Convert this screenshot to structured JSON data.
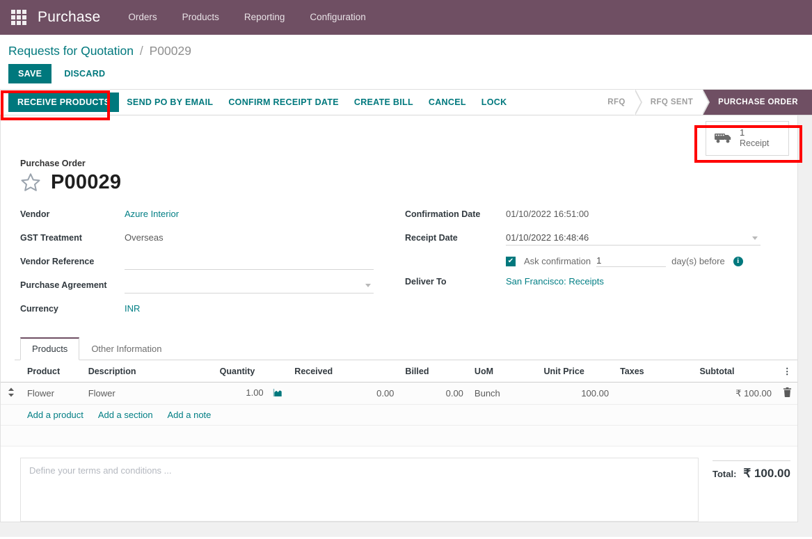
{
  "navbar": {
    "apps_icon": "apps-grid-icon",
    "brand": "Purchase",
    "menu": [
      "Orders",
      "Products",
      "Reporting",
      "Configuration"
    ]
  },
  "breadcrumb": {
    "parent": "Requests for Quotation",
    "separator": "/",
    "current": "P00029"
  },
  "edit_controls": {
    "save_label": "SAVE",
    "discard_label": "DISCARD"
  },
  "statusbar": {
    "buttons": [
      {
        "label": "RECEIVE PRODUCTS",
        "primary": true
      },
      {
        "label": "SEND PO BY EMAIL",
        "primary": false
      },
      {
        "label": "CONFIRM RECEIPT DATE",
        "primary": false
      },
      {
        "label": "CREATE BILL",
        "primary": false
      },
      {
        "label": "CANCEL",
        "primary": false
      },
      {
        "label": "LOCK",
        "primary": false
      }
    ],
    "stages": [
      {
        "label": "RFQ",
        "active": false
      },
      {
        "label": "RFQ SENT",
        "active": false
      },
      {
        "label": "PURCHASE ORDER",
        "active": true
      }
    ]
  },
  "smart_buttons": [
    {
      "icon": "truck-icon",
      "value": "1",
      "label": "Receipt"
    }
  ],
  "record": {
    "title_label": "Purchase Order",
    "star_icon": "star-icon",
    "name": "P00029"
  },
  "form": {
    "left": [
      {
        "label": "Vendor",
        "value": "Azure Interior",
        "style": "link"
      },
      {
        "label": "GST Treatment",
        "value": "Overseas",
        "style": "text"
      },
      {
        "label": "Vendor Reference",
        "value": "",
        "style": "underline"
      },
      {
        "label": "Purchase Agreement",
        "value": "",
        "style": "dropdown"
      },
      {
        "label": "Currency",
        "value": "INR",
        "style": "link"
      }
    ],
    "right": [
      {
        "label": "Confirmation Date",
        "value": "01/10/2022 16:51:00",
        "style": "text"
      },
      {
        "label": "Receipt Date",
        "value": "01/10/2022 16:48:46",
        "style": "datesel"
      }
    ],
    "ask_confirmation": {
      "checked": true,
      "check_glyph": "✔",
      "label": "Ask confirmation",
      "days": "1",
      "suffix": "day(s) before",
      "info_icon": "info-icon",
      "info_glyph": "i"
    },
    "deliver_to": {
      "label": "Deliver To",
      "value": "San Francisco: Receipts"
    }
  },
  "notebook": {
    "tabs": [
      {
        "label": "Products",
        "active": true
      },
      {
        "label": "Other Information",
        "active": false
      }
    ]
  },
  "order_lines": {
    "columns": [
      "Product",
      "Description",
      "Quantity",
      "Received",
      "Billed",
      "UoM",
      "Unit Price",
      "Taxes",
      "Subtotal"
    ],
    "options_icon": "vertical-dots-icon",
    "rows": [
      {
        "handle_icon": "drag-handle-icon",
        "product": "Flower",
        "description": "Flower",
        "quantity": "1.00",
        "forecast_icon": "area-chart-icon",
        "received": "0.00",
        "billed": "0.00",
        "uom": "Bunch",
        "unit_price": "100.00",
        "taxes": "",
        "subtotal": "₹ 100.00",
        "delete_icon": "trash-icon"
      }
    ],
    "add_links": [
      "Add a product",
      "Add a section",
      "Add a note"
    ]
  },
  "terms": {
    "placeholder": "Define your terms and conditions ..."
  },
  "totals": {
    "label": "Total:",
    "value": "₹ 100.00"
  },
  "colors": {
    "navbar_purple": "#6f4f63",
    "primary_teal": "#00787d",
    "link_teal": "#017e84",
    "annotation_red": "#ff0000",
    "stage_inactive": "#9e9e9e"
  },
  "annotations": [
    {
      "name": "receive-products-highlight",
      "target": "RECEIVE PRODUCTS"
    },
    {
      "name": "receipt-smartbutton-highlight",
      "target": "1 Receipt"
    }
  ]
}
